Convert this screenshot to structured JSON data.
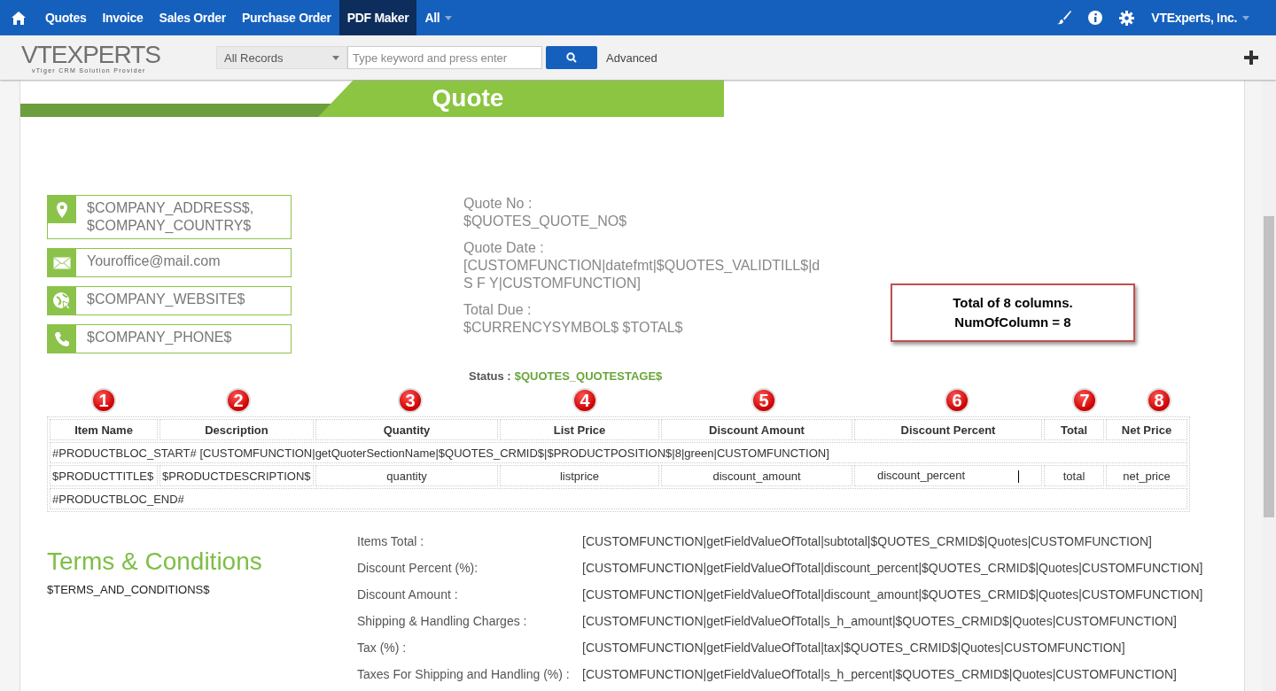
{
  "nav": {
    "items": [
      {
        "label": "Quotes",
        "selected": false
      },
      {
        "label": "Invoice",
        "selected": false
      },
      {
        "label": "Sales Order",
        "selected": false
      },
      {
        "label": "Purchase Order",
        "selected": false
      },
      {
        "label": "PDF Maker",
        "selected": true
      },
      {
        "label": "All",
        "selected": false
      }
    ],
    "user": "VTExperts, Inc."
  },
  "toolbar": {
    "logo": "VTEXPERTS",
    "tagline": "vTiger CRM Solution Provider",
    "scope": "All Records",
    "search": {
      "placeholder": "Type keyword and press enter"
    },
    "advanced": "Advanced"
  },
  "document": {
    "banner_title": "Quote",
    "contacts": [
      {
        "kind": "address",
        "lines": [
          "$COMPANY_ADDRESS$,",
          "$COMPANY_COUNTRY$"
        ]
      },
      {
        "kind": "email",
        "lines": [
          "Youroffice@mail.com"
        ]
      },
      {
        "kind": "website",
        "lines": [
          "$COMPANY_WEBSITE$"
        ]
      },
      {
        "kind": "phone",
        "lines": [
          "$COMPANY_PHONE$"
        ]
      }
    ],
    "info": [
      {
        "label": "Quote No :",
        "value": "$QUOTES_QUOTE_NO$"
      },
      {
        "label": "Quote Date :",
        "value": "[CUSTOMFUNCTION|datefmt|$QUOTES_VALIDTILL$|d S F Y|CUSTOMFUNCTION]"
      },
      {
        "label": "Total Due :",
        "value": "$CURRENCYSYMBOL$ $TOTAL$"
      }
    ],
    "callout": [
      "Total of 8 columns.",
      "NumOfColumn = 8"
    ],
    "status": {
      "label": "Status :",
      "value": "$QUOTES_QUOTESTAGE$"
    },
    "table": {
      "columns": [
        {
          "badge": "1",
          "label": "Item Name"
        },
        {
          "badge": "2",
          "label": "Description"
        },
        {
          "badge": "3",
          "label": "Quantity"
        },
        {
          "badge": "4",
          "label": "List Price"
        },
        {
          "badge": "5",
          "label": "Discount Amount"
        },
        {
          "badge": "6",
          "label": "Discount Percent"
        },
        {
          "badge": "7",
          "label": "Total"
        },
        {
          "badge": "8",
          "label": "Net Price"
        }
      ],
      "start_row": "#PRODUCTBLOC_START# [CUSTOMFUNCTION|getQuoterSectionName|$QUOTES_CRMID$|$PRODUCTPOSITION$|8|green|CUSTOMFUNCTION]",
      "row": [
        "$PRODUCTTITLE$",
        "$PRODUCTDESCRIPTION$",
        "quantity",
        "listprice",
        "discount_amount",
        "discount_percent",
        "total",
        "net_price"
      ],
      "end_row": "#PRODUCTBLOC_END#"
    },
    "terms": {
      "title": "Terms & Conditions",
      "text": "$TERMS_AND_CONDITIONS$"
    },
    "totals": [
      {
        "label": "Items Total :",
        "value": "[CUSTOMFUNCTION|getFieldValueOfTotal|subtotal|$QUOTES_CRMID$|Quotes|CUSTOMFUNCTION]"
      },
      {
        "label": "Discount Percent (%):",
        "value": "[CUSTOMFUNCTION|getFieldValueOfTotal|discount_percent|$QUOTES_CRMID$|Quotes|CUSTOMFUNCTION]"
      },
      {
        "label": "Discount Amount :",
        "value": "[CUSTOMFUNCTION|getFieldValueOfTotal|discount_amount|$QUOTES_CRMID$|Quotes|CUSTOMFUNCTION]"
      },
      {
        "label": "Shipping & Handling Charges :",
        "value": "[CUSTOMFUNCTION|getFieldValueOfTotal|s_h_amount|$QUOTES_CRMID$|Quotes|CUSTOMFUNCTION]"
      },
      {
        "label": "Tax (%) :",
        "value": "[CUSTOMFUNCTION|getFieldValueOfTotal|tax|$QUOTES_CRMID$|Quotes|CUSTOMFUNCTION]"
      },
      {
        "label": "Taxes For Shipping and Handling (%) :",
        "value": "[CUSTOMFUNCTION|getFieldValueOfTotal|s_h_percent|$QUOTES_CRMID$|Quotes|CUSTOMFUNCTION]"
      }
    ]
  }
}
